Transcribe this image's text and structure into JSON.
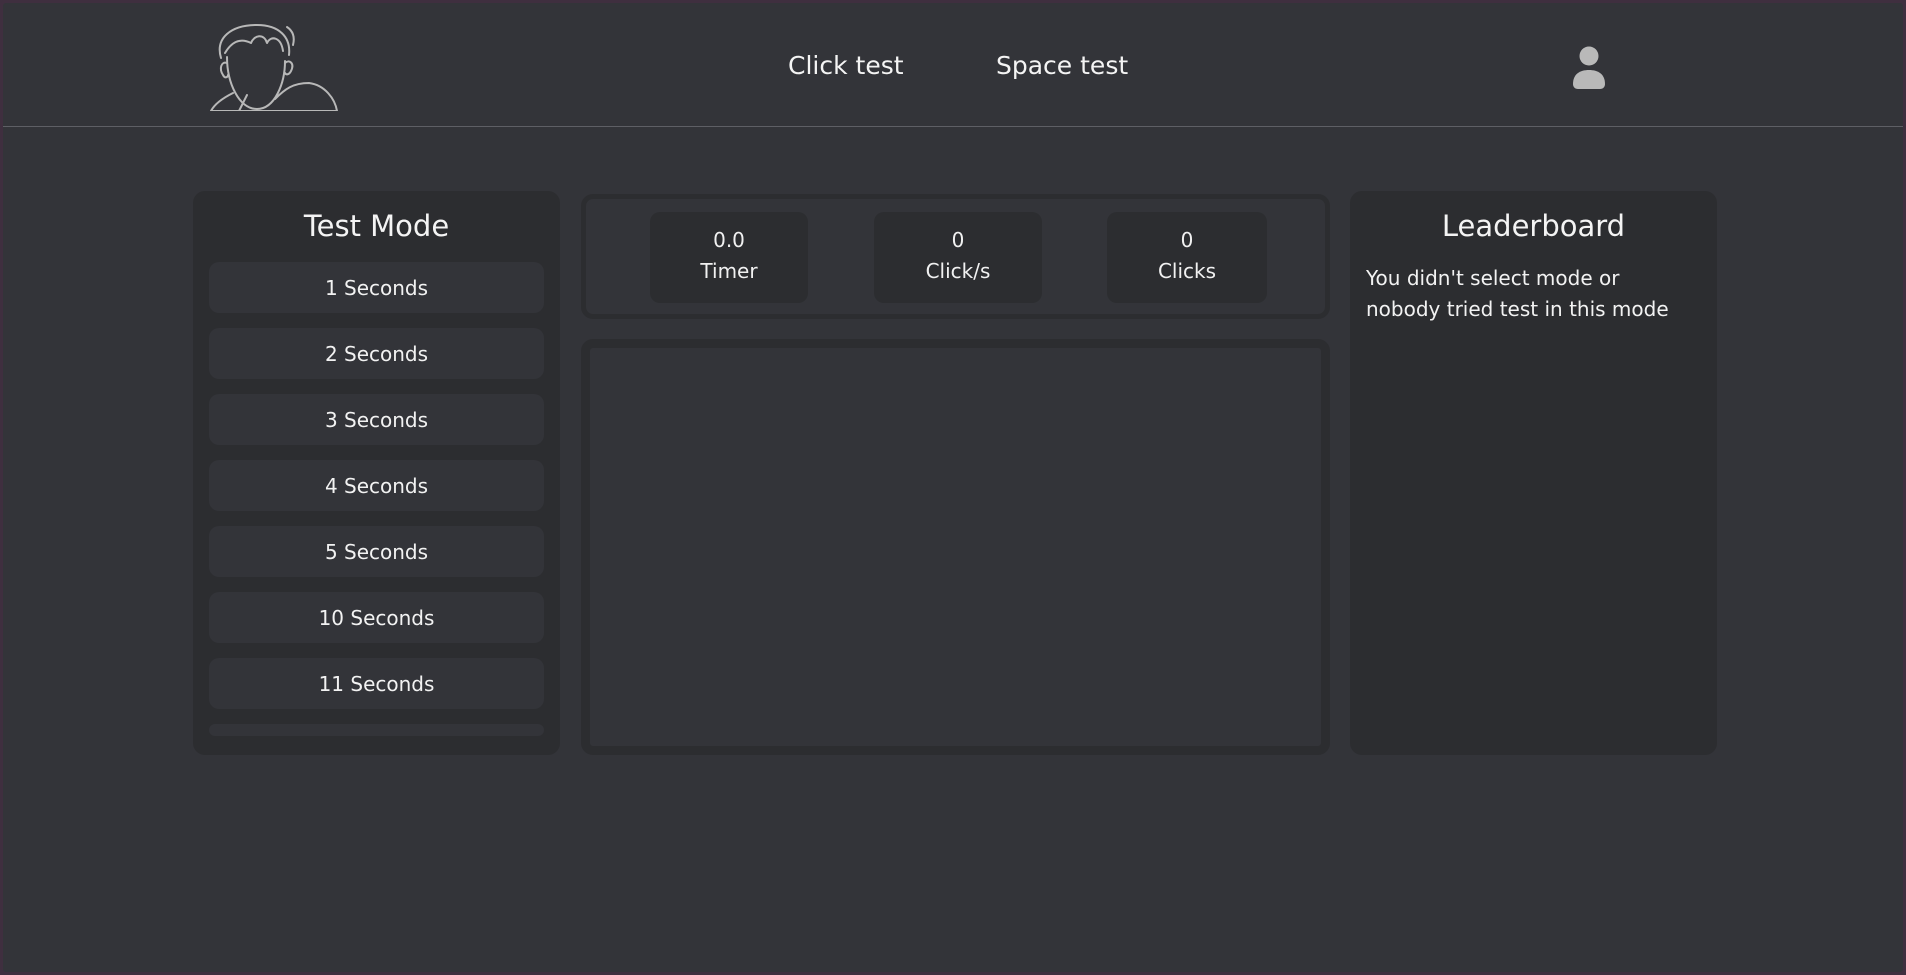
{
  "nav": {
    "links": [
      {
        "label": "Click test"
      },
      {
        "label": "Space test"
      }
    ]
  },
  "test_mode": {
    "title": "Test Mode",
    "items": [
      {
        "label": "1 Seconds"
      },
      {
        "label": "2 Seconds"
      },
      {
        "label": "3 Seconds"
      },
      {
        "label": "4 Seconds"
      },
      {
        "label": "5 Seconds"
      },
      {
        "label": "10 Seconds"
      },
      {
        "label": "11 Seconds"
      }
    ]
  },
  "stats": {
    "timer": {
      "value": "0.0",
      "label": "Timer"
    },
    "cps": {
      "value": "0",
      "label": "Click/s"
    },
    "clicks": {
      "value": "0",
      "label": "Clicks"
    }
  },
  "leaderboard": {
    "title": "Leaderboard",
    "message": "You didn't select mode or nobody tried test in this mode"
  },
  "icons": {
    "logo": "avatar-sketch-logo",
    "user": "user-icon"
  },
  "colors": {
    "background": "#333439",
    "panel": "#2c2d30",
    "text": "#f1f1f1"
  }
}
